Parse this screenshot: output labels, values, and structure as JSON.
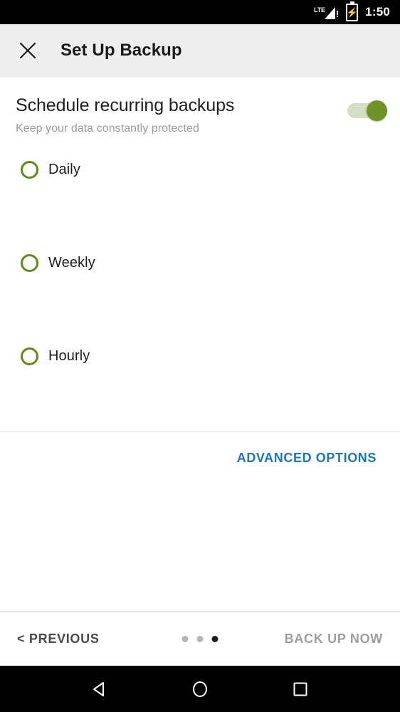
{
  "status_bar": {
    "network_label": "LTE",
    "network_warning": "!",
    "time": "1:50",
    "signal_icon": "signal-triangle-icon",
    "battery_icon": "battery-charging-icon"
  },
  "app_bar": {
    "close_icon": "close-x-icon",
    "title": "Set Up Backup",
    "background": "#eeeeee"
  },
  "main": {
    "section_title": "Schedule recurring backups",
    "section_subtitle": "Keep your data constantly protected",
    "toggle": {
      "name": "schedule-recurring-backups-toggle",
      "state": "on",
      "thumb_color": "#6f9425",
      "track_color": "#d3dec3"
    },
    "options": [
      {
        "label": "Daily",
        "selected": false
      },
      {
        "label": "Weekly",
        "selected": false
      },
      {
        "label": "Hourly",
        "selected": false
      }
    ],
    "option_ring_color": "#5f8b1d",
    "advanced_options_label": "ADVANCED OPTIONS",
    "advanced_options_color": "#1b77b5"
  },
  "bottom_bar": {
    "previous_label": "< PREVIOUS",
    "next_label": "BACK UP NOW",
    "next_color": "#9e9e9e",
    "pager": {
      "total": 3,
      "active_index": 2
    }
  },
  "nav_bar": {
    "back_icon": "back-triangle-icon",
    "home_icon": "home-circle-icon",
    "recents_icon": "recents-square-icon"
  }
}
